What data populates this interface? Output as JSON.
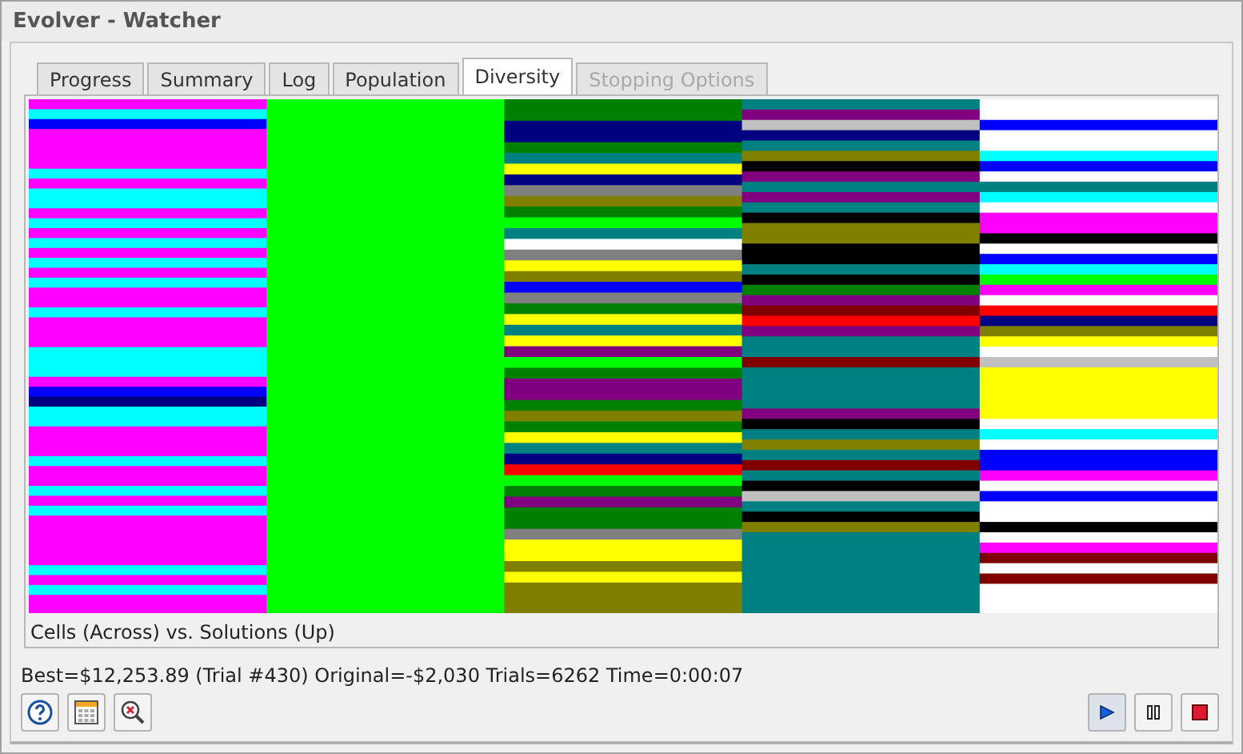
{
  "window": {
    "title": "Evolver - Watcher"
  },
  "tabs": [
    {
      "label": "Progress",
      "selected": false,
      "disabled": false
    },
    {
      "label": "Summary",
      "selected": false,
      "disabled": false
    },
    {
      "label": "Log",
      "selected": false,
      "disabled": false
    },
    {
      "label": "Population",
      "selected": false,
      "disabled": false
    },
    {
      "label": "Diversity",
      "selected": true,
      "disabled": false
    },
    {
      "label": "Stopping Options",
      "selected": false,
      "disabled": true
    }
  ],
  "diversity": {
    "kind": "picture",
    "caption": "Cells (Across) vs. Solutions (Up)"
  },
  "status": "Best=$12,253.89 (Trial #430) Original=-$2,030 Trials=6262 Time=0:00:07",
  "tools": [
    {
      "kind": "help"
    },
    {
      "kind": "spreadsheet"
    },
    {
      "kind": "zoom"
    }
  ],
  "run_controls": [
    {
      "kind": "play",
      "active": true
    },
    {
      "kind": "pause",
      "active": false
    },
    {
      "kind": "stop",
      "active": false
    }
  ]
}
